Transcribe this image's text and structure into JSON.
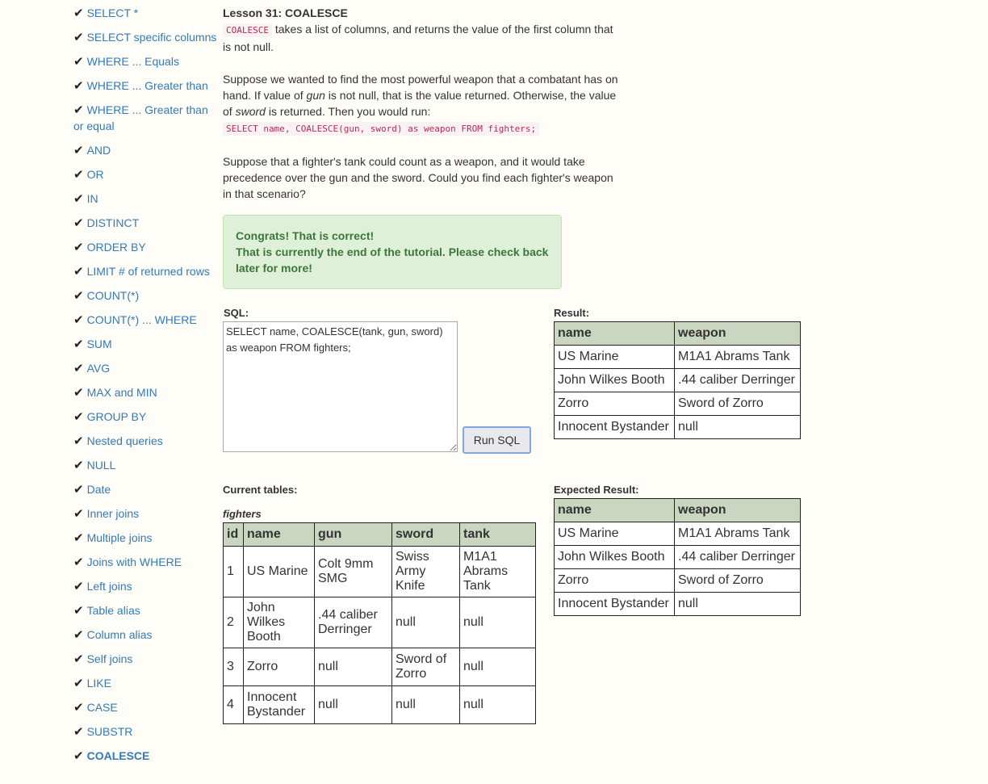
{
  "sidebar": {
    "items": [
      {
        "label": "SELECT *"
      },
      {
        "label": "SELECT specific columns"
      },
      {
        "label": "WHERE ... Equals"
      },
      {
        "label": "WHERE ... Greater than"
      },
      {
        "label": "WHERE ... Greater than or equal"
      },
      {
        "label": "AND"
      },
      {
        "label": "OR"
      },
      {
        "label": "IN"
      },
      {
        "label": "DISTINCT"
      },
      {
        "label": "ORDER BY"
      },
      {
        "label": "LIMIT # of returned rows"
      },
      {
        "label": "COUNT(*)"
      },
      {
        "label": "COUNT(*) ... WHERE"
      },
      {
        "label": "SUM"
      },
      {
        "label": "AVG"
      },
      {
        "label": "MAX and MIN"
      },
      {
        "label": "GROUP BY"
      },
      {
        "label": "Nested queries"
      },
      {
        "label": "NULL"
      },
      {
        "label": "Date"
      },
      {
        "label": "Inner joins"
      },
      {
        "label": "Multiple joins"
      },
      {
        "label": "Joins with WHERE"
      },
      {
        "label": "Left joins"
      },
      {
        "label": "Table alias"
      },
      {
        "label": "Column alias"
      },
      {
        "label": "Self joins"
      },
      {
        "label": "LIKE"
      },
      {
        "label": "CASE"
      },
      {
        "label": "SUBSTR"
      },
      {
        "label": "COALESCE"
      }
    ],
    "check_glyph": "✔"
  },
  "lesson": {
    "title": "Lesson 31: COALESCE",
    "p1_code": "COALESCE",
    "p1_text": " takes a list of columns, and returns the value of the first column that is not null.",
    "p2_a": "Suppose we wanted to find the most powerful weapon that a combatant has on hand. If value of ",
    "p2_gun": "gun",
    "p2_b": " is not null, that is the value returned. Otherwise, the value of ",
    "p2_sword": "sword",
    "p2_c": " is returned. Then you would run:",
    "p2_code": "SELECT name, COALESCE(gun, sword) as weapon FROM fighters;",
    "p3": "Suppose that a fighter's tank could count as a weapon, and it would take precedence over the gun and the sword. Could you find each fighter's weapon in that scenario?"
  },
  "success": {
    "line1": "Congrats! That is correct!",
    "line2": "That is currently the end of the tutorial. Please check back later for more!"
  },
  "editor": {
    "label": "SQL:",
    "value": "SELECT name, COALESCE(tank, gun, sword) as weapon FROM fighters;",
    "run_label": "Run SQL"
  },
  "result": {
    "label": "Result:",
    "headers": [
      "name",
      "weapon"
    ],
    "rows": [
      [
        "US Marine",
        "M1A1 Abrams Tank"
      ],
      [
        "John Wilkes Booth",
        ".44 caliber Derringer"
      ],
      [
        "Zorro",
        "Sword of Zorro"
      ],
      [
        "Innocent Bystander",
        "null"
      ]
    ]
  },
  "expected": {
    "label": "Expected Result:",
    "headers": [
      "name",
      "weapon"
    ],
    "rows": [
      [
        "US Marine",
        "M1A1 Abrams Tank"
      ],
      [
        "John Wilkes Booth",
        ".44 caliber Derringer"
      ],
      [
        "Zorro",
        "Sword of Zorro"
      ],
      [
        "Innocent Bystander",
        "null"
      ]
    ]
  },
  "current_tables": {
    "label": "Current tables:",
    "table_name": "fighters",
    "headers": [
      "id",
      "name",
      "gun",
      "sword",
      "tank"
    ],
    "rows": [
      [
        "1",
        "US Marine",
        "Colt 9mm SMG",
        "Swiss Army Knife",
        "M1A1 Abrams Tank"
      ],
      [
        "2",
        "John Wilkes Booth",
        ".44 caliber Derringer",
        "null",
        "null"
      ],
      [
        "3",
        "Zorro",
        "null",
        "Sword of Zorro",
        "null"
      ],
      [
        "4",
        "Innocent Bystander",
        "null",
        "null",
        "null"
      ]
    ]
  }
}
